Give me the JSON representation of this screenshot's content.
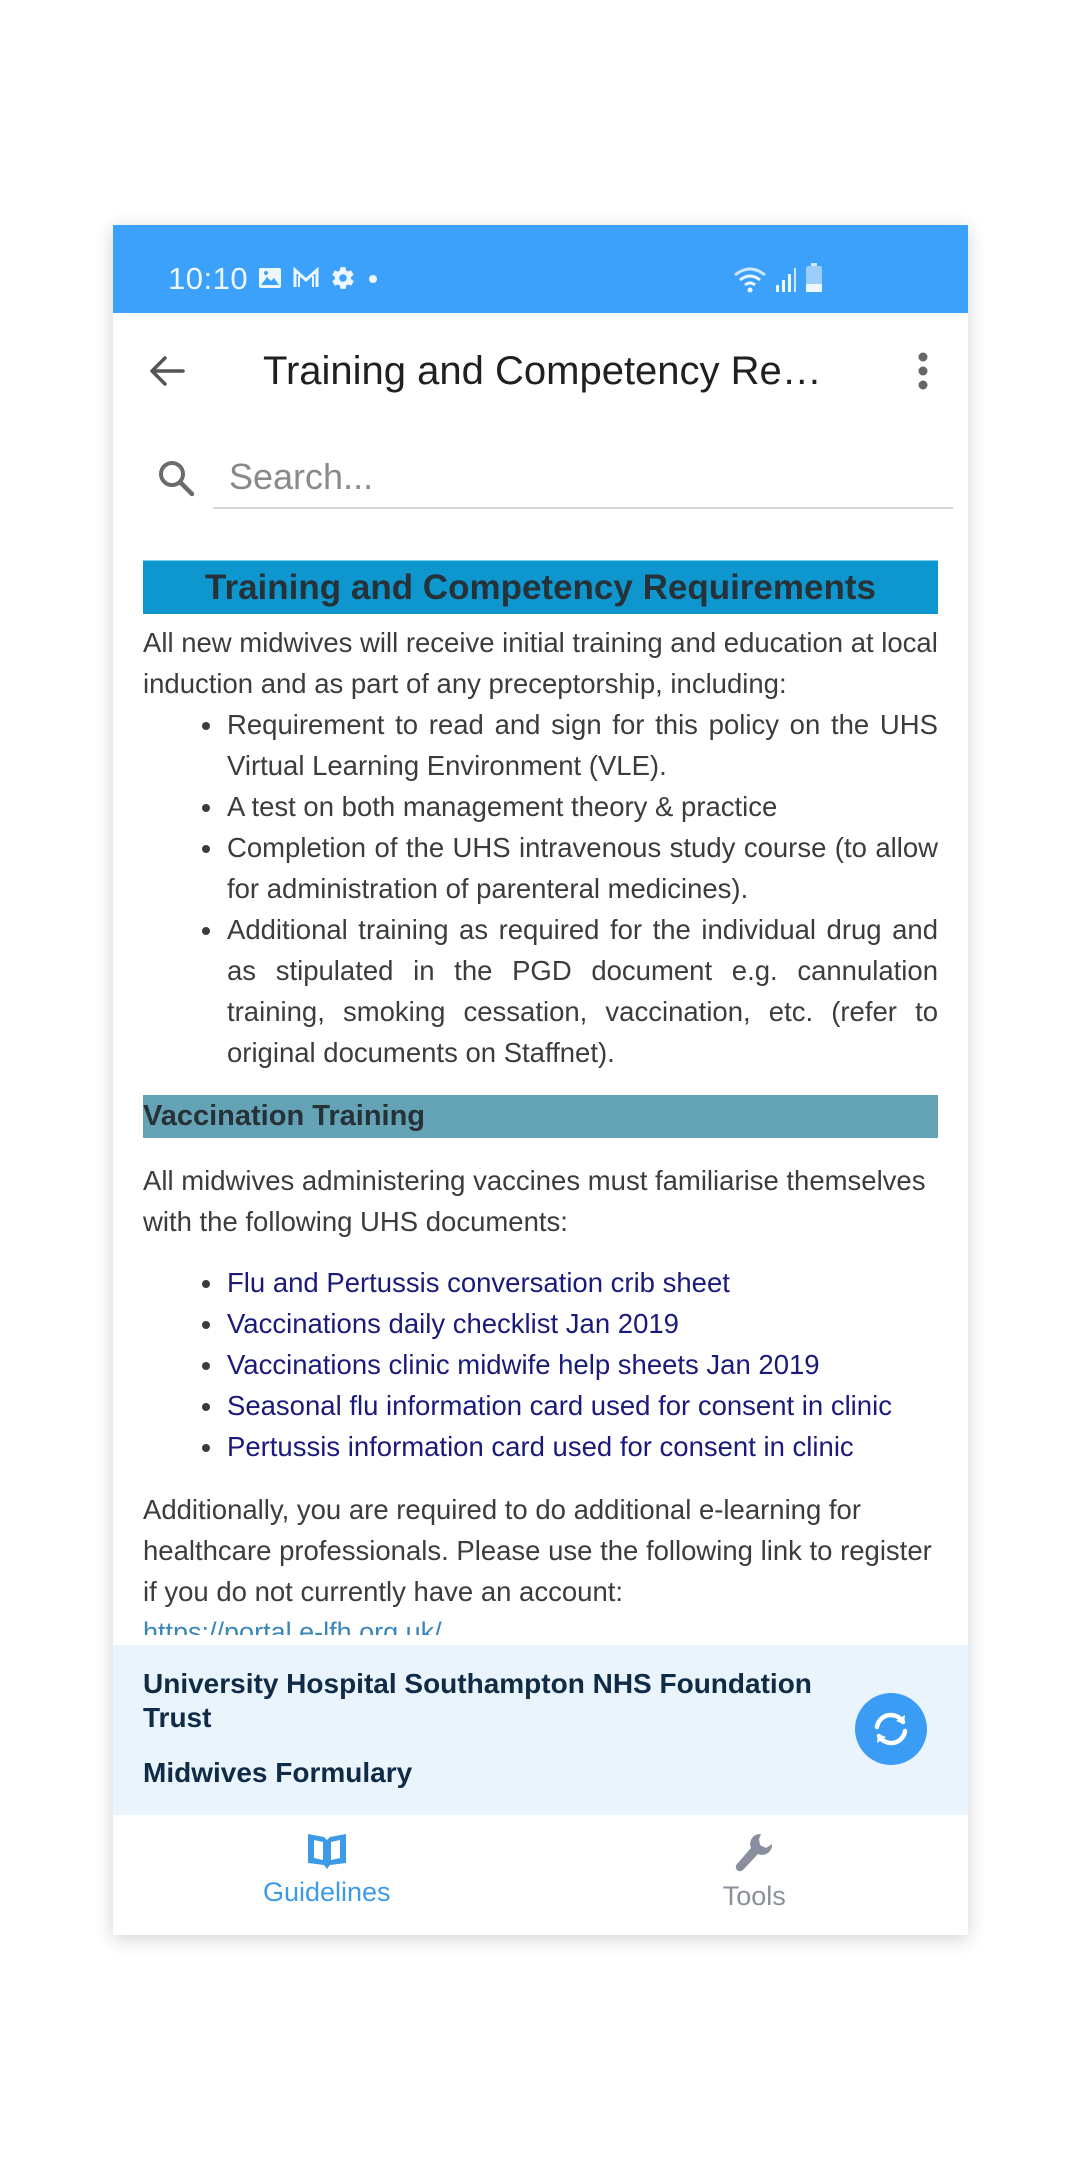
{
  "status_bar": {
    "time": "10:10",
    "left_icons": [
      "gallery-icon",
      "gmail-icon",
      "settings-icon",
      "dot-icon"
    ],
    "right_icons": [
      "wifi-icon",
      "signal-icon",
      "battery-icon"
    ]
  },
  "app_bar": {
    "title": "Training and Competency Req...",
    "back_icon": "arrow-left-icon",
    "menu_icon": "more-vert-icon"
  },
  "search": {
    "placeholder": "Search...",
    "value": ""
  },
  "content": {
    "heading": "Training and Competency Requirements",
    "intro": "All new midwives will receive initial training and education at local induction and as part of any preceptorship, including:",
    "requirements": [
      "Requirement to read and sign for this policy on the UHS Virtual Learning Environment (VLE).",
      "A test on both management theory & practice",
      "Completion of the UHS intravenous study course (to allow for administration of parenteral medicines).",
      "Additional training as required for the individual drug and as stipulated in the PGD document e.g. cannulation training, smoking cessation, vaccination, etc. (refer to original documents on Staffnet)."
    ],
    "vaccination_heading": "Vaccination Training",
    "vaccination_intro": "All midwives administering vaccines must familiarise themselves with the following UHS documents:",
    "vaccination_documents": [
      "Flu and Pertussis conversation crib sheet",
      "Vaccinations daily checklist Jan 2019",
      "Vaccinations clinic midwife help sheets Jan 2019",
      "Seasonal flu information card used for consent in clinic",
      "Pertussis information card used for consent in clinic"
    ],
    "elearning_text": "Additionally, you are required to do additional e-learning for healthcare professionals.  Please use the following link to register if you do not currently have an account:",
    "elearning_link": "https://portal.e-lfh.org.uk/"
  },
  "footer": {
    "organisation": "University Hospital Southampton NHS Foundation Trust",
    "app_name": "Midwives Formulary",
    "refresh_icon": "refresh-icon"
  },
  "bottom_nav": {
    "items": [
      {
        "label": "Guidelines",
        "icon": "book-icon",
        "active": true
      },
      {
        "label": "Tools",
        "icon": "wrench-icon",
        "active": false
      }
    ]
  },
  "colors": {
    "status_bar": "#3ba1fb",
    "heading_bg": "#0e97cf",
    "subheading_bg": "#64a3b5",
    "link": "#1a1a7a",
    "footer_bg": "#eaf4fd",
    "accent": "#3d9ae6"
  }
}
